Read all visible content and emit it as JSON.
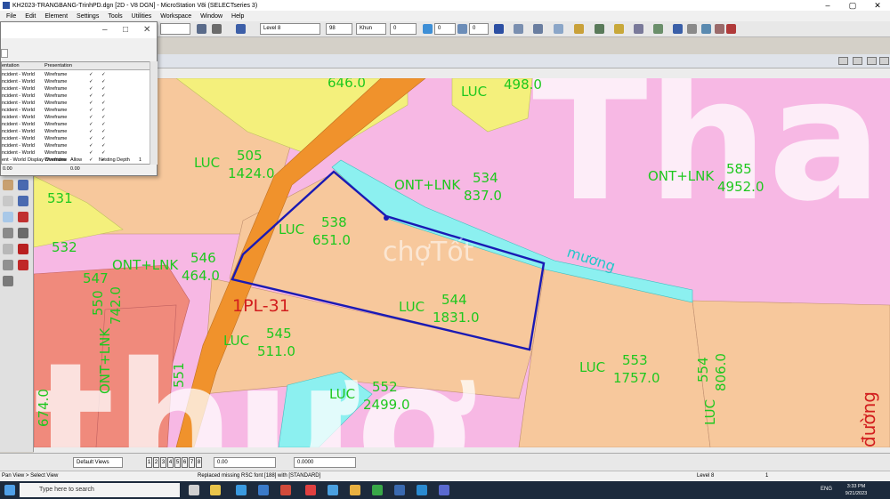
{
  "window": {
    "title": "KH2023-TRANGBANG-TrinhPD.dgn [2D - V8 DGN] - MicroStation V8i (SELECTseries 3)",
    "controls": [
      "–",
      "▢",
      "✕"
    ]
  },
  "menu": [
    "File",
    "Edit",
    "Element",
    "Settings",
    "Tools",
    "Utilities",
    "Workspace",
    "Window",
    "Help"
  ],
  "toolbar": {
    "level": "Level 8",
    "weight": "98",
    "linestyle": "Khun",
    "lw_value": "0",
    "transparency": "0",
    "priority": "0"
  },
  "dialog": {
    "controls": [
      "–",
      "□",
      "✕"
    ],
    "columns": [
      "entation",
      "Presentation"
    ],
    "rows": [
      {
        "name": "ncident - World",
        "presentation": "Wireframe"
      },
      {
        "name": "ncident - World",
        "presentation": "Wireframe"
      },
      {
        "name": "ncident - World",
        "presentation": "Wireframe"
      },
      {
        "name": "ncident - World",
        "presentation": "Wireframe"
      },
      {
        "name": "ncident - World",
        "presentation": "Wireframe"
      },
      {
        "name": "ncident - World",
        "presentation": "Wireframe"
      },
      {
        "name": "ncident - World",
        "presentation": "Wireframe"
      },
      {
        "name": "ncident - World",
        "presentation": "Wireframe"
      },
      {
        "name": "ncident - World",
        "presentation": "Wireframe"
      },
      {
        "name": "ncident - World",
        "presentation": "Wireframe"
      },
      {
        "name": "ncident - World",
        "presentation": "Wireframe"
      },
      {
        "name": "ncident - World",
        "presentation": "Wireframe"
      },
      {
        "name": "ent - World",
        "presentation": "Wireframe"
      }
    ],
    "field_a": "0.00",
    "field_b": "0.00",
    "display_overrides_label": "Display Overrides",
    "display_overrides_value": "Allow",
    "nesting_label": "Nesting Depth",
    "nesting_value": "1"
  },
  "map": {
    "parcels": [
      {
        "code": "LUC",
        "number": "505",
        "area": "1424.0"
      },
      {
        "code": "LUC",
        "number": "498.0",
        "area": ""
      },
      {
        "code": "ONT+LNK",
        "number": "534",
        "area": "837.0"
      },
      {
        "code": "ONT+LNK",
        "number": "585",
        "area": "4952.0"
      },
      {
        "code": "LUC",
        "number": "538",
        "area": "651.0"
      },
      {
        "code": "ONT+LNK",
        "number": "546",
        "area": "464.0"
      },
      {
        "code": "LUC",
        "number": "544",
        "area": "1831.0"
      },
      {
        "code": "LUC",
        "number": "545",
        "area": "511.0"
      },
      {
        "code": "LUC",
        "number": "553",
        "area": "1757.0"
      },
      {
        "code": "LUC",
        "number": "552",
        "area": "2499.0"
      },
      {
        "code": "LUC",
        "number": "554",
        "area": "806.0"
      },
      {
        "code": "ONT+LNK",
        "number": "550",
        "area": "742.0"
      }
    ],
    "loose_numbers": [
      "531",
      "532",
      "547",
      "551",
      "674.0",
      "646.0"
    ],
    "plot_label": "1PL-31",
    "canal_label": "mương",
    "road_label": "đường",
    "watermark": "chợTốt"
  },
  "bottom": {
    "view_label": "Default Views",
    "view_numbers": [
      "1",
      "2",
      "3",
      "4",
      "5",
      "6",
      "7",
      "8"
    ],
    "field1": "0.00",
    "field2": "0.0000"
  },
  "status": {
    "left": "Pan View > Select View",
    "middle": "Replaced missing RSC font [188] with [STANDARD]",
    "level": "Level 8",
    "count": "1"
  },
  "taskbar": {
    "search_placeholder": "Type here to search",
    "lang": "ENG",
    "time": "3:33 PM",
    "date": "9/21/2023"
  },
  "colors": {
    "pink": "#f7b8e4",
    "peach": "#f7c89c",
    "yellow": "#f4f07c",
    "salmon": "#f08a7c",
    "road": "#f0922c",
    "canal": "#8cf0f0",
    "boundary": "#1a1ab4",
    "label_green": "#1ec81e",
    "label_red": "#d21e1e"
  }
}
